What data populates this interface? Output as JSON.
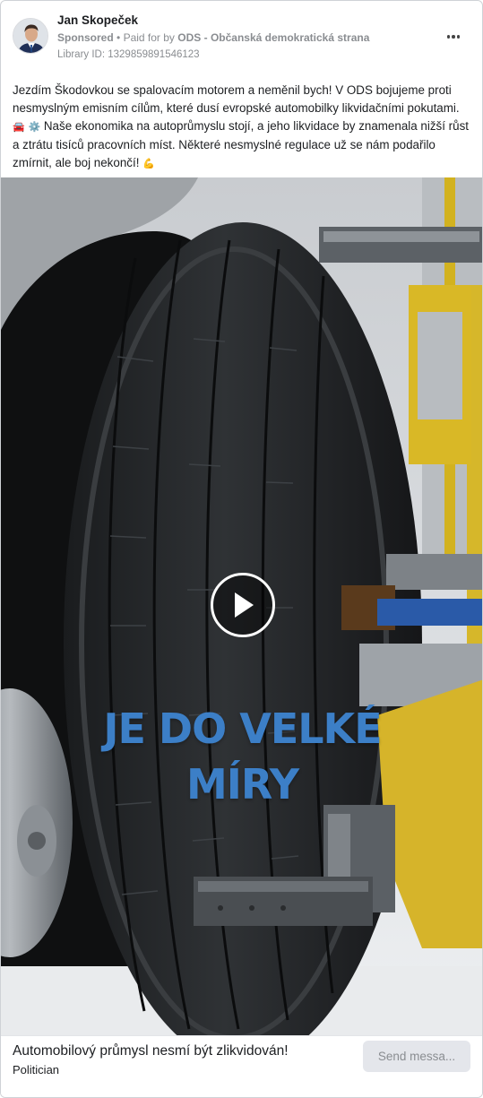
{
  "post": {
    "author": "Jan Skopeček",
    "sponsored_label": "Sponsored",
    "separator": "•",
    "paid_for_prefix": "Paid for by",
    "payer": "ODS - Občanská demokratická strana",
    "library_id": "Library ID: 1329859891546123",
    "text_part1": "Jezdím Škodovkou se spalovacím motorem a neměnil bych! V ODS bojujeme proti nesmyslným emisním cílům, které dusí evropské automobilky likvidačními pokutami.",
    "emoji1": "🚘",
    "emoji2": "⚙️",
    "text_part2": "Naše ekonomika na autoprůmyslu stojí, a jeho likvidace by znamenala nižší růst a ztrátu tisíců pracovních míst. Některé nesmyslné regulace už se nám podařilo zmírnit, ale boj nekončí!",
    "emoji3": "💪"
  },
  "video": {
    "overlay_line1": "JE DO VELKÉ",
    "overlay_line2": "MÍRY",
    "overlay_color": "#3c7fc7"
  },
  "footer": {
    "title": "Automobilový průmysl nesmí být zlikvidován!",
    "subtitle": "Politician",
    "cta_label": "Send messa..."
  },
  "icons": {
    "more": "more-horizontal-icon",
    "play": "play-icon"
  }
}
